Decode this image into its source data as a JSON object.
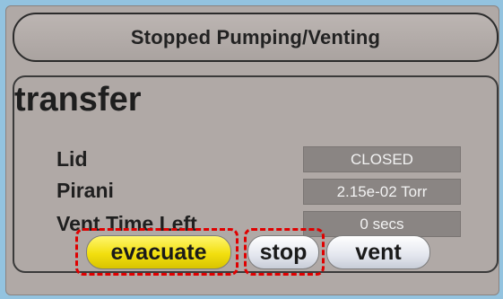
{
  "status": {
    "text": "Stopped Pumping/Venting"
  },
  "group": {
    "title": "transfer",
    "rows": [
      {
        "label": "Lid",
        "value": "CLOSED"
      },
      {
        "label": "Pirani",
        "value": "2.15e-02 Torr"
      },
      {
        "label": "Vent Time Left",
        "value": "0 secs"
      }
    ]
  },
  "buttons": {
    "evacuate": "evacuate",
    "stop": "stop",
    "vent": "vent"
  },
  "colors": {
    "background": "#93c3df",
    "panel": "#b0a9a6",
    "value_box": "#8a8583",
    "evacuate_button": "#f2df0f",
    "highlight": "#e00000"
  }
}
